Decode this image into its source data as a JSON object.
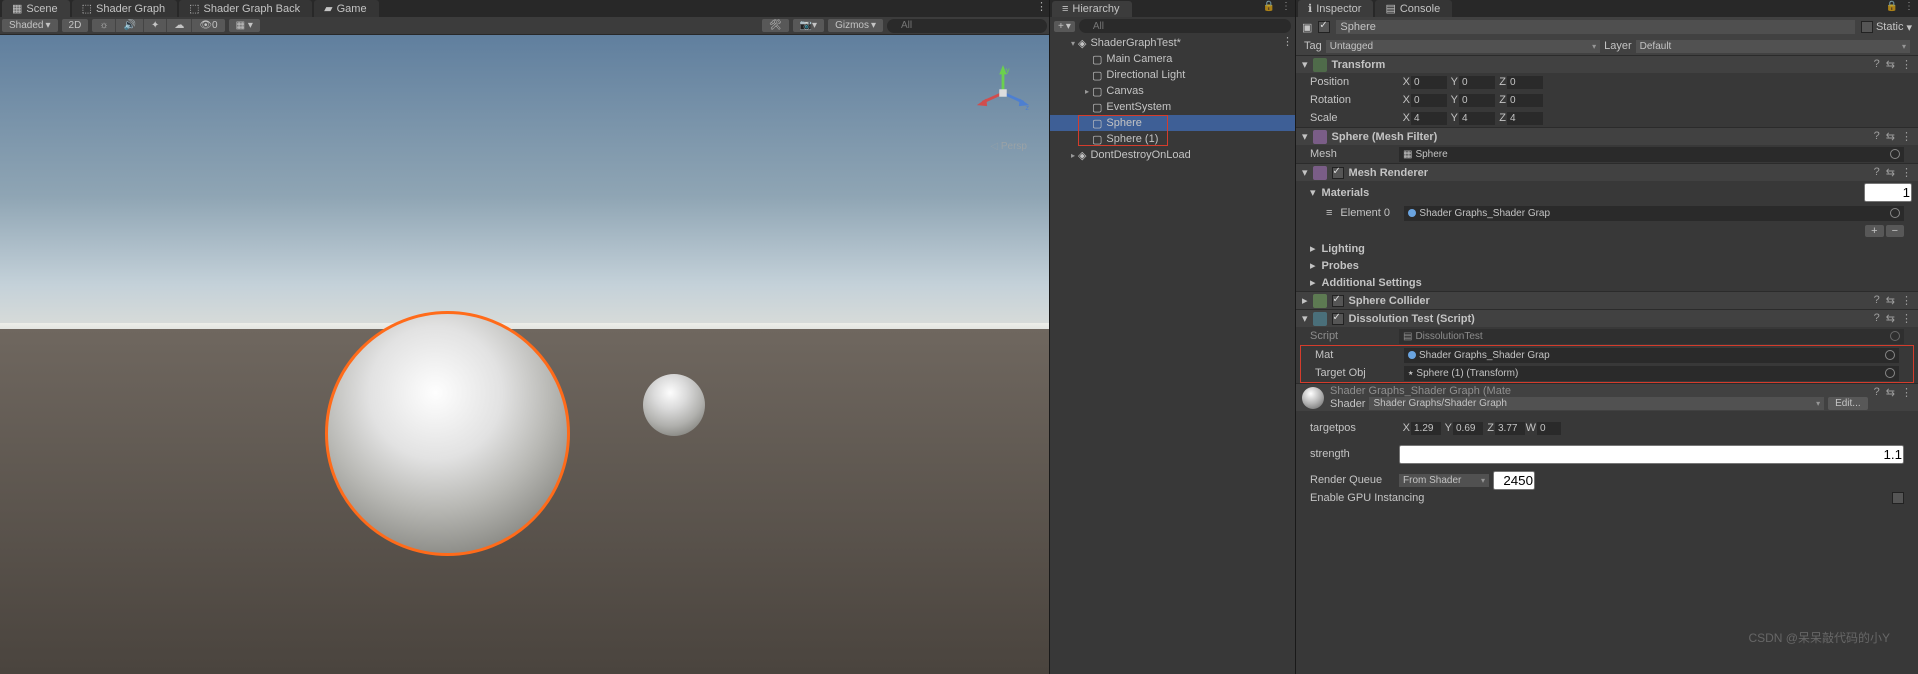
{
  "scene": {
    "tabs": [
      "Scene",
      "Shader Graph",
      "Shader Graph Back",
      "Game"
    ],
    "toolbar": {
      "shading": "Shaded",
      "view2d": "2D",
      "gizmos": "Gizmos",
      "search_ph": "All"
    },
    "persp": "Persp"
  },
  "hierarchy": {
    "title": "Hierarchy",
    "search_ph": "All",
    "addMenu": "+",
    "root": "ShaderGraphTest*",
    "items": [
      {
        "label": "Main Camera",
        "indent": 2
      },
      {
        "label": "Directional Light",
        "indent": 2
      },
      {
        "label": "Canvas",
        "indent": 2,
        "expandable": true
      },
      {
        "label": "EventSystem",
        "indent": 2
      },
      {
        "label": "Sphere",
        "indent": 2,
        "sel": true,
        "hl": true
      },
      {
        "label": "Sphere (1)",
        "indent": 2,
        "hl": true
      },
      {
        "label": "DontDestroyOnLoad",
        "indent": 1,
        "expandable": true
      }
    ]
  },
  "inspector": {
    "tabs": [
      "Inspector",
      "Console"
    ],
    "name": "Sphere",
    "static_label": "Static",
    "tag_label": "Tag",
    "tag_value": "Untagged",
    "layer_label": "Layer",
    "layer_value": "Default",
    "transform": {
      "title": "Transform",
      "position": {
        "label": "Position",
        "x": "0",
        "y": "0",
        "z": "0"
      },
      "rotation": {
        "label": "Rotation",
        "x": "0",
        "y": "0",
        "z": "0"
      },
      "scale": {
        "label": "Scale",
        "x": "4",
        "y": "4",
        "z": "4"
      }
    },
    "mesh_filter": {
      "title": "Sphere (Mesh Filter)",
      "mesh_label": "Mesh",
      "mesh_value": "Sphere"
    },
    "mesh_renderer": {
      "title": "Mesh Renderer",
      "materials_label": "Materials",
      "materials_count": "1",
      "element0_label": "Element 0",
      "element0_value": "Shader Graphs_Shader Grap",
      "lighting": "Lighting",
      "probes": "Probes",
      "additional": "Additional Settings"
    },
    "sphere_collider": {
      "title": "Sphere Collider"
    },
    "dissolution": {
      "title": "Dissolution Test (Script)",
      "script_label": "Script",
      "script_value": "DissolutionTest",
      "mat_label": "Mat",
      "mat_value": "Shader Graphs_Shader Grap",
      "target_label": "Target Obj",
      "target_value": "Sphere (1) (Transform)"
    },
    "material": {
      "title": "Shader Graphs_Shader Graph (Mate",
      "shader_label": "Shader",
      "shader_value": "Shader Graphs/Shader Graph",
      "edit": "Edit...",
      "targetpos_label": "targetpos",
      "tx": "1.29",
      "ty": "0.69",
      "tz": "3.77",
      "tw": "0",
      "strength_label": "strength",
      "strength": "1.1",
      "render_queue_label": "Render Queue",
      "render_queue_mode": "From Shader",
      "render_queue_value": "2450",
      "gpu_instancing": "Enable GPU Instancing"
    }
  },
  "watermark": "CSDN @呆呆敲代码的小Y"
}
